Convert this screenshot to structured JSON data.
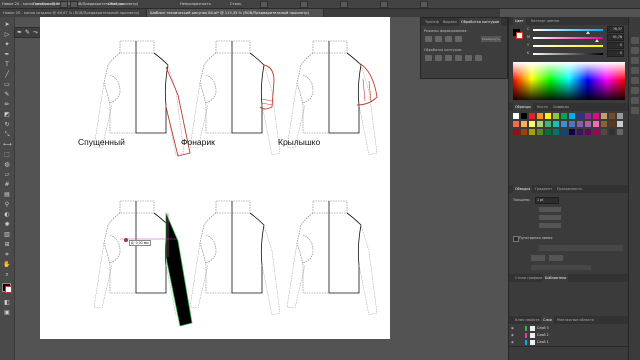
{
  "menubar": {
    "items": [
      "Новое 20 - копия создано @ 66,67 % (RGB/Предварительный просмотр)",
      "Преобразовать"
    ],
    "controls": [
      "Обводка",
      "Непрозрачность",
      "Стиль"
    ]
  },
  "tabs": [
    {
      "label": "Новое 20 - копия создано @ 66,67 % (RGB/Предварительный просмотр)",
      "active": false
    },
    {
      "label": "Шаблон технический рисунок 84.ai* @ 113,33 % (RGB/Предварительный просмотр)",
      "active": true
    }
  ],
  "canvas": {
    "labels": {
      "sleeve1": "Спущенный",
      "sleeve2": "Фонарик",
      "sleeve3": "Крылышко"
    },
    "tooltip": "Д: 0,00 мм"
  },
  "pathfinder": {
    "tabs": [
      "Трансф",
      "Выравн",
      "Обработка контуров"
    ],
    "modes_label": "Режимы формирования:",
    "pathfinders_label": "Обработка контуров:",
    "expand_label": "Развернуть"
  },
  "right_panel": {
    "color": {
      "tabs": [
        "Цвет",
        "Каталог цветов"
      ],
      "sliders": [
        {
          "label": "C",
          "value": "78,37"
        },
        {
          "label": "M",
          "value": "91,78"
        },
        {
          "label": "Y",
          "value": "0"
        },
        {
          "label": "K",
          "value": "0"
        }
      ]
    },
    "swatches": {
      "tabs": [
        "Образцы",
        "Кисти",
        "Символы"
      ]
    },
    "stroke": {
      "tabs": [
        "Обводка",
        "Градиент",
        "Прозрачность"
      ],
      "weight_label": "Толщина:",
      "weight_value": "1 pt",
      "check_label": "Пунктирная линия"
    },
    "bottom_tabs": [
      "Стили графики",
      "Библиотеки"
    ],
    "layers": {
      "tabs": [
        "Ключ свойств",
        "Слои",
        "Монтажные области"
      ],
      "rows": [
        "Слой 3",
        "Слой 2",
        "Слой 1"
      ]
    }
  },
  "colors": {
    "accent_red": "#c0392b",
    "selection_magenta": "#d946a8",
    "selection_green": "#39b54a"
  }
}
